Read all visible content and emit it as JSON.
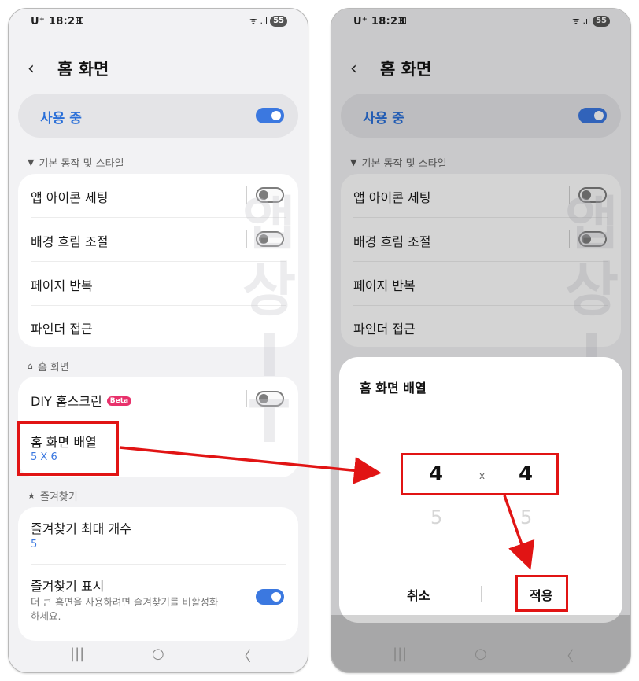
{
  "status": {
    "carrier": "U⁺ 18:23",
    "rec_icon": "⊡",
    "signal": "ᯤ .ıl",
    "battery": "55"
  },
  "header": {
    "back_icon": "‹",
    "title": "홈 화면"
  },
  "master_toggle": {
    "label": "사용 중",
    "on": true
  },
  "section_basic": {
    "icon": "▼",
    "title": "기본 동작 및 스타일",
    "items": [
      {
        "label": "앱 아이콘 세팅"
      },
      {
        "label": "배경 흐림 조절"
      },
      {
        "label": "페이지 반복"
      },
      {
        "label": "파인더 접근"
      }
    ]
  },
  "section_home": {
    "icon": "⌂",
    "title": "홈 화면",
    "diy_label": "DIY 홈스크린",
    "beta": "Beta",
    "grid_label": "홈 화면 배열",
    "grid_value": "5 X 6"
  },
  "section_fav": {
    "icon": "★",
    "title": "즐겨찾기",
    "max_label": "즐겨찾기 최대 개수",
    "max_value": "5",
    "show_label": "즐겨찾기 표시",
    "show_desc": "더 큰 홈면을 사용하려면 즐겨찾기를 비활성화하세요."
  },
  "watermark": {
    "chars": [
      "앱",
      "상",
      "I",
      "T"
    ]
  },
  "dialog": {
    "title": "홈 화면 배열",
    "col_value": "4",
    "sep": "x",
    "row_value": "4",
    "col_next": "5",
    "row_next": "5",
    "cancel": "취소",
    "apply": "적용"
  },
  "nav": {
    "recent": "|||",
    "home": "○",
    "back": "〈"
  },
  "colors": {
    "accent": "#3b78e0",
    "highlight": "#e11414",
    "beta": "#e8316b"
  }
}
